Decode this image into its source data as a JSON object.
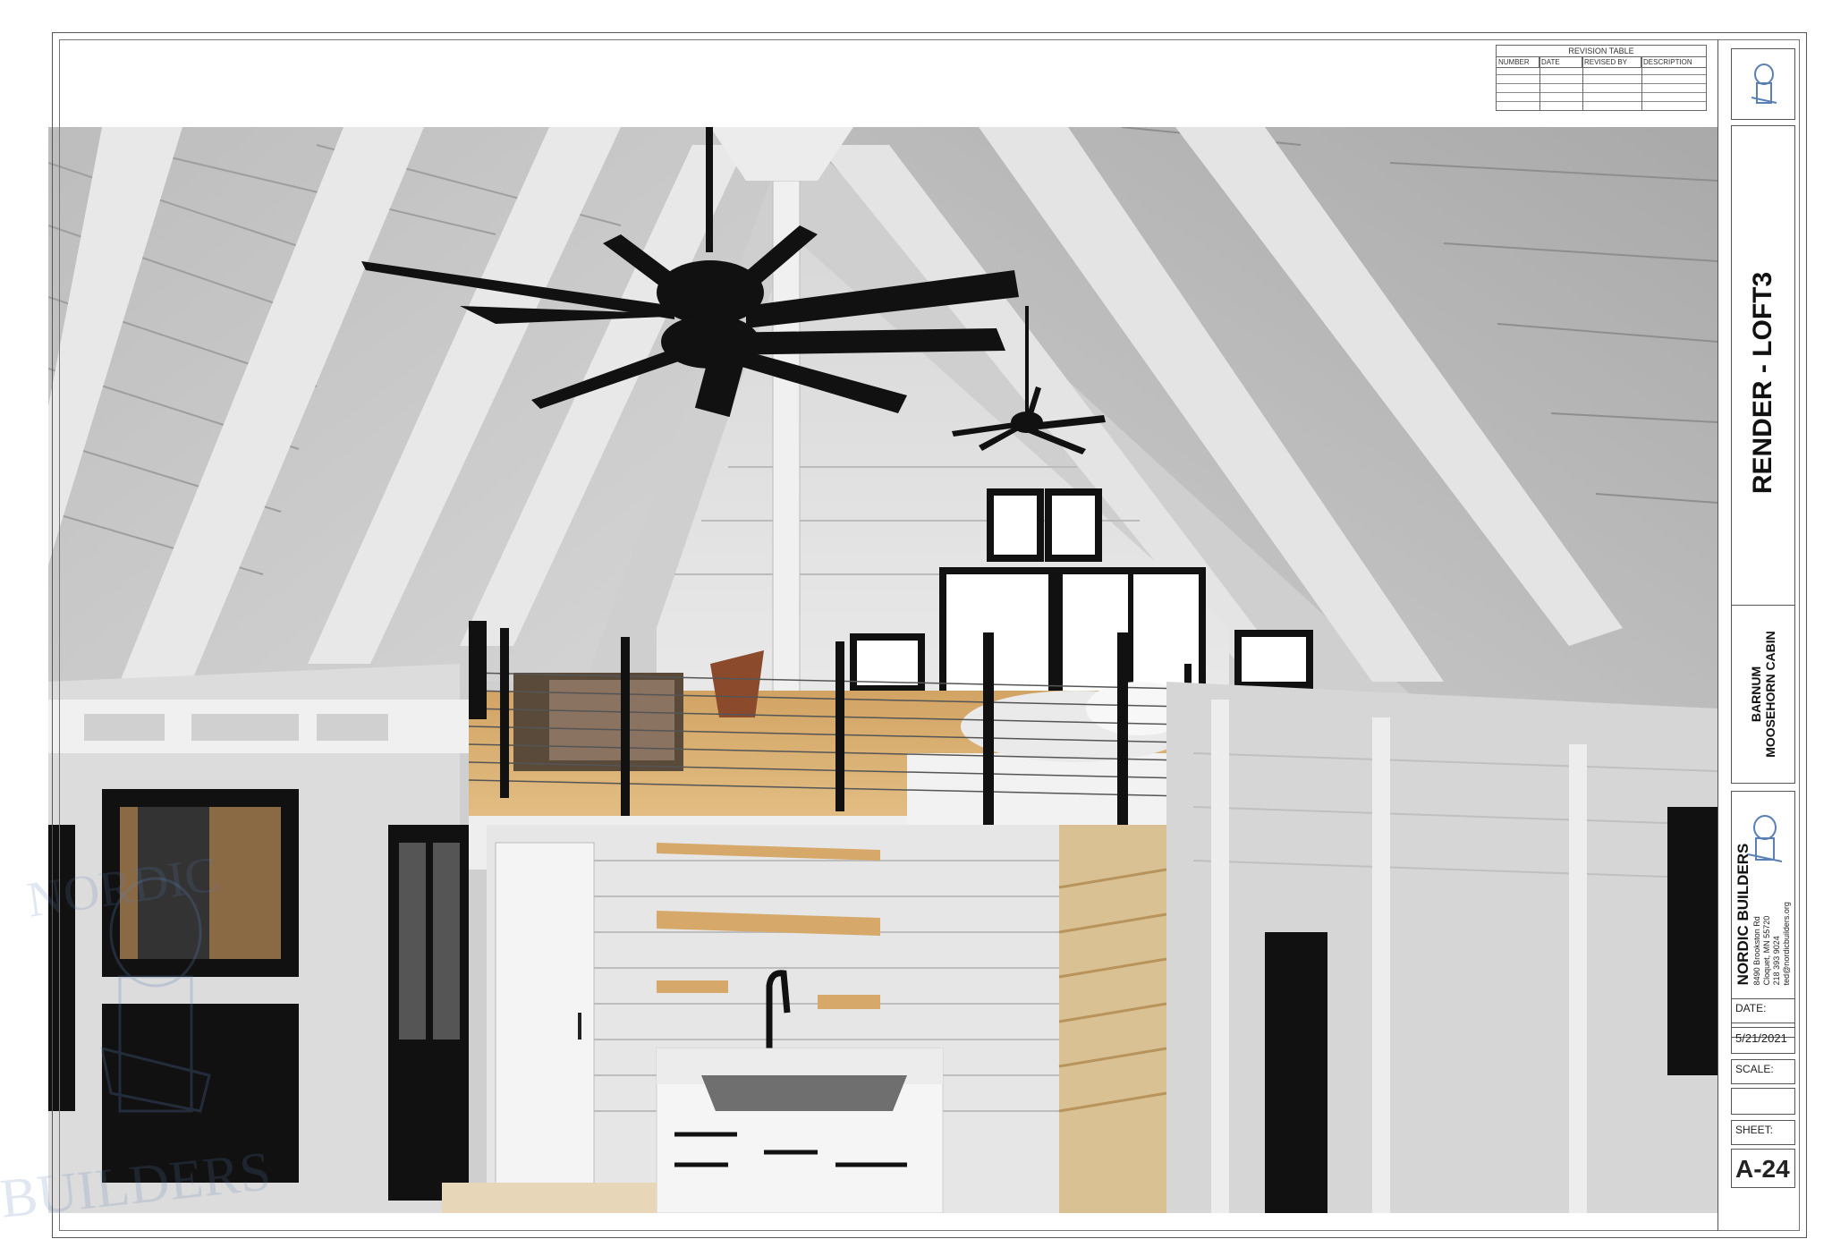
{
  "revision_table": {
    "caption": "REVISION TABLE",
    "columns": [
      "NUMBER",
      "DATE",
      "REVISED BY",
      "DESCRIPTION"
    ]
  },
  "title_block": {
    "sheet_title": "RENDER - LOFT3",
    "project_line1": "BARNUM",
    "project_line2": "MOOSEHORN CABIN",
    "company_name": "NORDIC BUILDERS",
    "address_lines": [
      "8490 Brookston Rd",
      "Cloquet, MN 55720",
      "218 393 9024",
      "ted@nordicbuilders.org"
    ],
    "logo_text": "NORDIC BUILDERS",
    "date_label": "DATE:",
    "date_value": "5/21/2021",
    "scale_label": "SCALE:",
    "scale_value": "",
    "sheet_label": "SHEET:",
    "sheet_value": "A-24"
  },
  "watermark": {
    "text_top": "NORDIC",
    "text_bottom": "BUILDERS"
  },
  "colors": {
    "wall": "#d9d9d9",
    "ceiling": "#c4c4c4",
    "trim_white": "#f2f2f2",
    "black": "#111111",
    "wood": "#d6a96a",
    "logo_blue": "#5a7fb5"
  }
}
